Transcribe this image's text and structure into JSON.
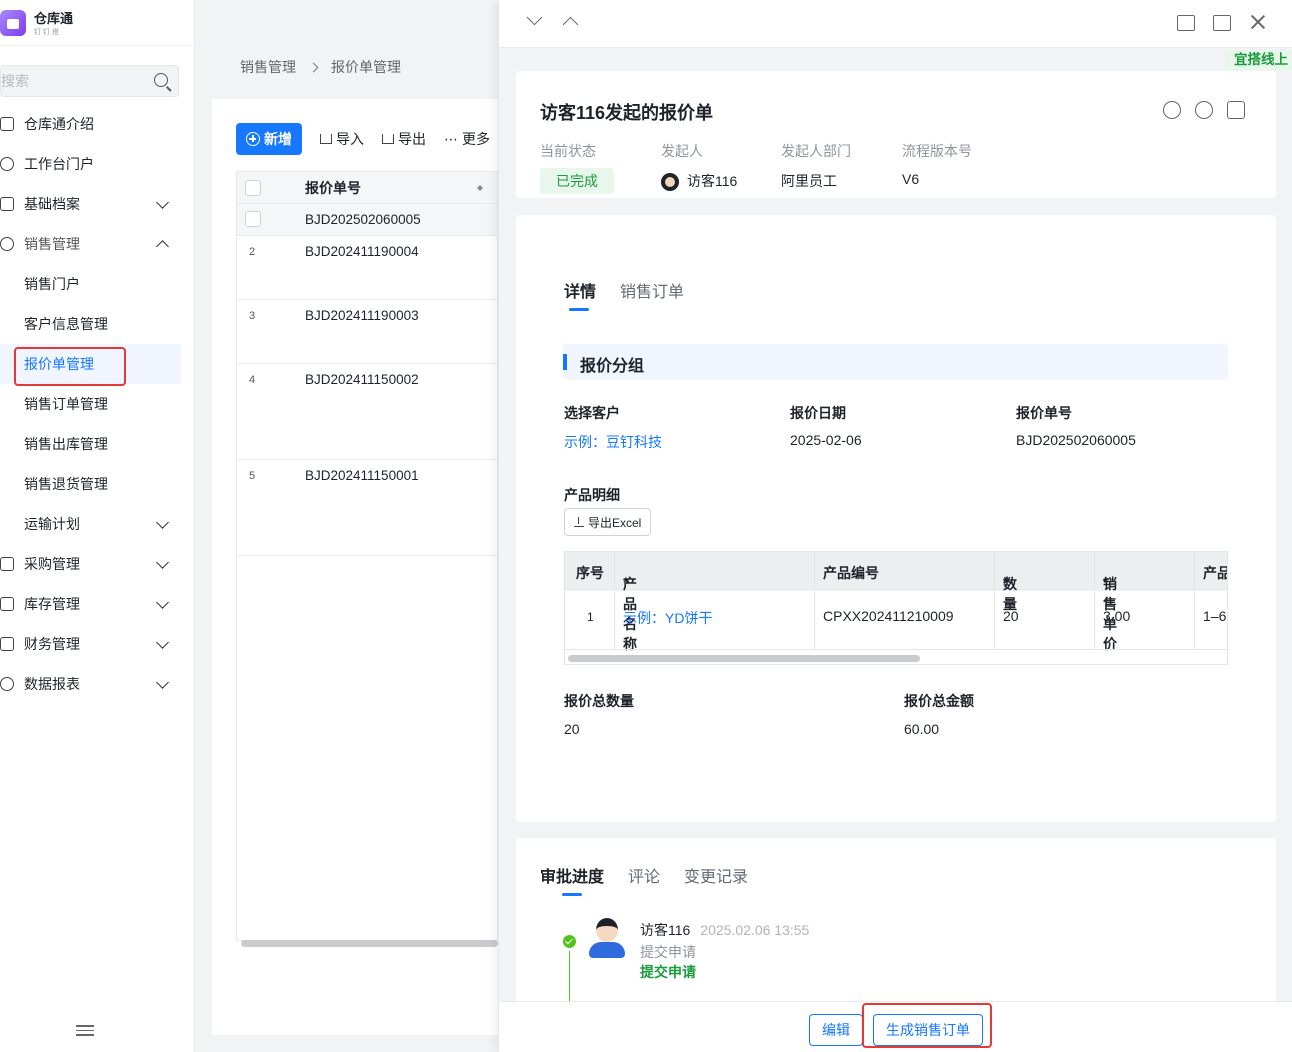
{
  "app": {
    "title": "仓库通",
    "subtitle": "钉钉搭"
  },
  "search": {
    "placeholder": "搜索"
  },
  "sidebar": {
    "items": [
      {
        "label": "仓库通介绍"
      },
      {
        "label": "工作台门户"
      },
      {
        "label": "基础档案"
      },
      {
        "label": "销售管理"
      },
      {
        "label": "销售门户"
      },
      {
        "label": "客户信息管理"
      },
      {
        "label": "报价单管理"
      },
      {
        "label": "销售订单管理"
      },
      {
        "label": "销售出库管理"
      },
      {
        "label": "销售退货管理"
      },
      {
        "label": "运输计划"
      },
      {
        "label": "采购管理"
      },
      {
        "label": "库存管理"
      },
      {
        "label": "财务管理"
      },
      {
        "label": "数据报表"
      }
    ]
  },
  "breadcrumb": {
    "parent": "销售管理",
    "current": "报价单管理"
  },
  "toolbar": {
    "add": "新增",
    "import": "导入",
    "export": "导出",
    "more": "更多"
  },
  "list": {
    "header": "报价单号",
    "rows": [
      {
        "index": "",
        "value": "BJD202502060005"
      },
      {
        "index": "2",
        "value": "BJD202411190004"
      },
      {
        "index": "3",
        "value": "BJD202411190003"
      },
      {
        "index": "4",
        "value": "BJD202411150002"
      },
      {
        "index": "5",
        "value": "BJD202411150001"
      }
    ]
  },
  "drawer": {
    "tag": "宜搭线上",
    "title": "访客116发起的报价单",
    "meta": {
      "status_label": "当前状态",
      "status_value": "已完成",
      "initiator_label": "发起人",
      "initiator_value": "访客116",
      "dept_label": "发起人部门",
      "dept_value": "阿里员工",
      "version_label": "流程版本号",
      "version_value": "V6"
    },
    "tabs": {
      "detail": "详情",
      "sales_order": "销售订单"
    },
    "group_title": "报价分组",
    "fields": {
      "customer_label": "选择客户",
      "customer_value": "示例：豆钉科技",
      "date_label": "报价日期",
      "date_value": "2025-02-06",
      "number_label": "报价单号",
      "number_value": "BJD202502060005"
    },
    "product_detail_label": "产品明细",
    "export_excel": "导出Excel",
    "product_table": {
      "headers": {
        "seq": "序号",
        "name": "产品名称",
        "code": "产品编号",
        "qty": "数量",
        "price": "销售单价",
        "more": "产品"
      },
      "row": {
        "seq": "1",
        "name": "示例：YD饼干",
        "code": "CPXX202411210009",
        "qty": "20",
        "price": "3.00",
        "more": "1–6"
      }
    },
    "totals": {
      "qty_label": "报价总数量",
      "qty_value": "20",
      "amount_label": "报价总金额",
      "amount_value": "60.00"
    },
    "approval_tabs": {
      "progress": "审批进度",
      "comments": "评论",
      "history": "变更记录"
    },
    "approval": {
      "name": "访客116",
      "time": "2025.02.06 13:55",
      "action": "提交申请",
      "status": "提交申请"
    },
    "footer": {
      "edit": "编辑",
      "generate": "生成销售订单"
    }
  }
}
